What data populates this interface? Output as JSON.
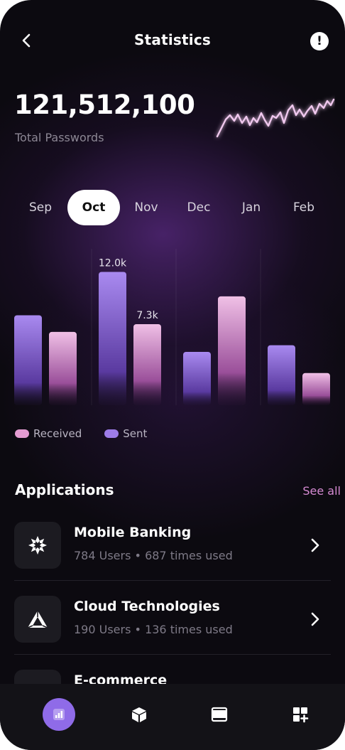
{
  "header": {
    "title": "Statistics",
    "info_label": "!"
  },
  "summary": {
    "total_value": "121,512,100",
    "total_label": "Total Passwords"
  },
  "months": [
    {
      "label": "Sep",
      "active": false
    },
    {
      "label": "Oct",
      "active": true
    },
    {
      "label": "Nov",
      "active": false
    },
    {
      "label": "Dec",
      "active": false
    },
    {
      "label": "Jan",
      "active": false
    },
    {
      "label": "Feb",
      "active": false
    }
  ],
  "chart_data": {
    "type": "bar",
    "categories": [
      "Sep",
      "Oct",
      "Nov",
      "Dec"
    ],
    "series": [
      {
        "name": "Sent",
        "color": "#9d7ce8",
        "values": [
          8.1,
          12.0,
          4.8,
          5.4
        ]
      },
      {
        "name": "Received",
        "color": "#e0a3d4",
        "values": [
          6.6,
          7.3,
          9.8,
          2.9
        ]
      }
    ],
    "data_labels": [
      {
        "series": "Sent",
        "category": "Oct",
        "text": "12.0k"
      },
      {
        "series": "Received",
        "category": "Oct",
        "text": "7.3k"
      }
    ],
    "ylim": [
      0,
      12.8
    ],
    "legend": "bottom-left"
  },
  "legend": [
    {
      "label": "Received",
      "color": "#e49cd2"
    },
    {
      "label": "Sent",
      "color": "#9d7ce8"
    }
  ],
  "applications": {
    "title": "Applications",
    "see_all": "See all",
    "items": [
      {
        "name": "Mobile Banking",
        "users": "784 Users",
        "uses": "687 times used",
        "icon": "snowflake-icon"
      },
      {
        "name": "Cloud Technologies",
        "users": "190 Users",
        "uses": "136 times used",
        "icon": "triangle-logo-icon"
      },
      {
        "name": "E-commerce",
        "users": "",
        "uses": "",
        "icon": "store-icon"
      }
    ]
  },
  "nav": [
    {
      "icon": "chart-icon",
      "active": true
    },
    {
      "icon": "box-icon",
      "active": false
    },
    {
      "icon": "window-icon",
      "active": false
    },
    {
      "icon": "grid-add-icon",
      "active": false
    }
  ],
  "colors": {
    "accent": "#8f6be8",
    "see_all": "#d58ad2"
  }
}
